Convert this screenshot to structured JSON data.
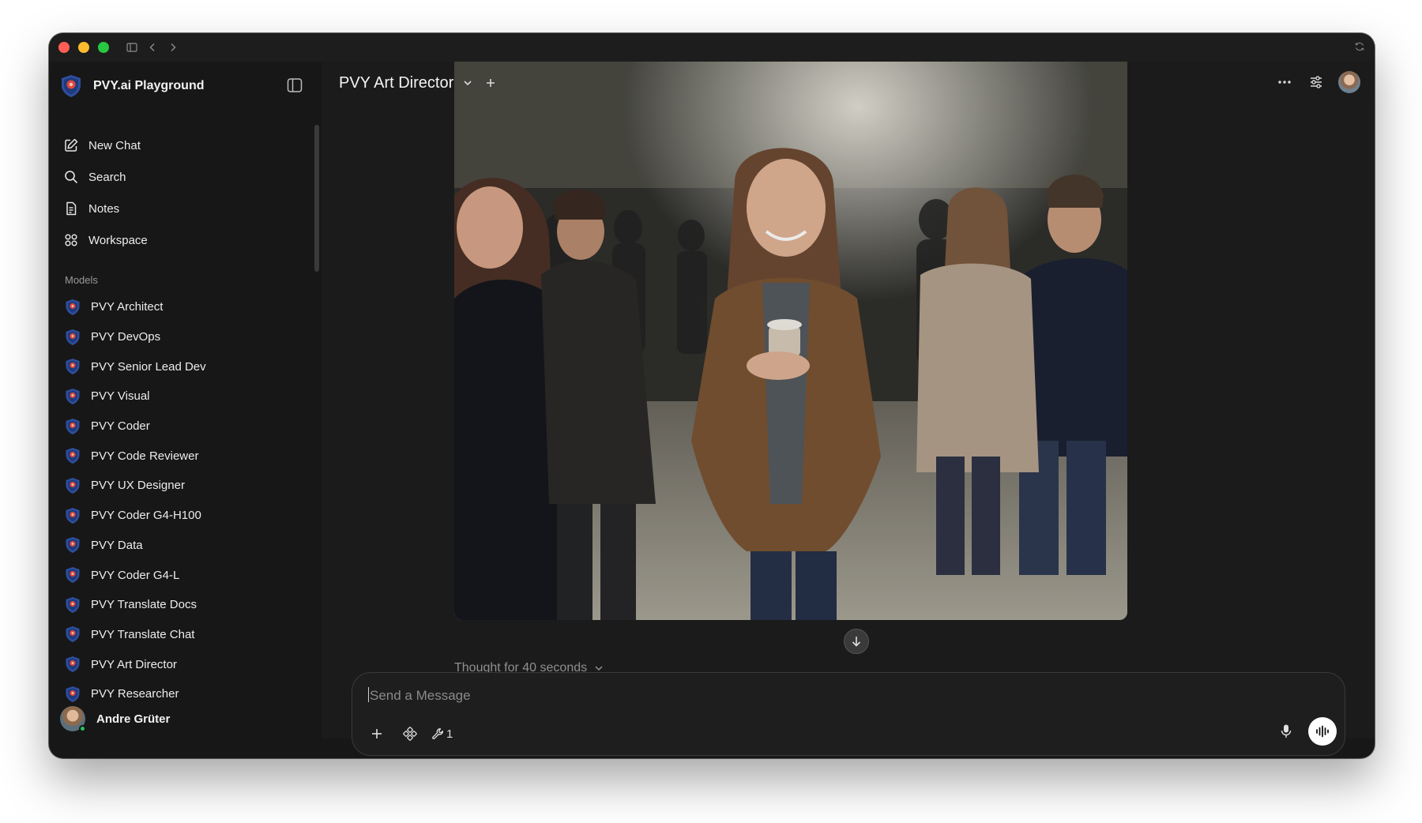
{
  "window": {
    "accent": "#ff5f57"
  },
  "sidebar": {
    "brand": "PVY.ai Playground",
    "nav": [
      {
        "label": "New Chat",
        "icon": "pencil-square-icon"
      },
      {
        "label": "Search",
        "icon": "search-icon"
      },
      {
        "label": "Notes",
        "icon": "notes-icon"
      },
      {
        "label": "Workspace",
        "icon": "workspace-icon"
      }
    ],
    "models_label": "Models",
    "models": [
      {
        "label": "PVY Architect"
      },
      {
        "label": "PVY DevOps"
      },
      {
        "label": "PVY Senior Lead Dev"
      },
      {
        "label": "PVY Visual"
      },
      {
        "label": "PVY Coder"
      },
      {
        "label": "PVY Code Reviewer"
      },
      {
        "label": "PVY UX Designer"
      },
      {
        "label": "PVY Coder G4-H100"
      },
      {
        "label": "PVY Data"
      },
      {
        "label": "PVY Coder G4-L"
      },
      {
        "label": "PVY Translate Docs"
      },
      {
        "label": "PVY Translate Chat"
      },
      {
        "label": "PVY Art Director"
      },
      {
        "label": "PVY Researcher"
      }
    ],
    "user": {
      "name": "Andre Grüter",
      "status": "online"
    }
  },
  "header": {
    "model_title": "PVY Art Director"
  },
  "message": {
    "thought": "Thought for 40 seconds"
  },
  "composer": {
    "placeholder": "Send a Message",
    "tools_count": "1"
  }
}
